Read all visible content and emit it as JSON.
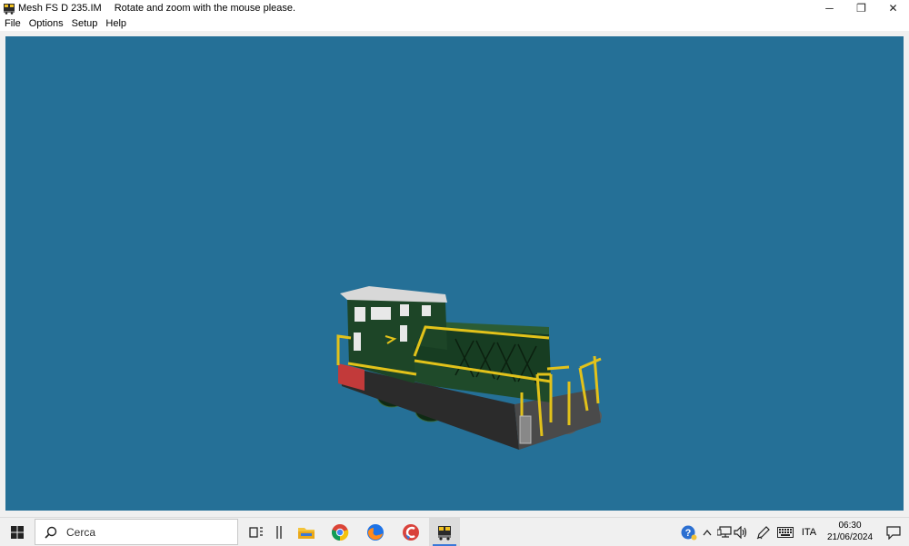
{
  "window": {
    "title": "Mesh FS D 235.IM",
    "hint": "Rotate and zoom with the mouse please.",
    "icon": "locomotive-icon",
    "controls": {
      "minimize": "─",
      "restore": "❐",
      "close": "✕"
    }
  },
  "menu": {
    "items": [
      "File",
      "Options",
      "Setup",
      "Help"
    ]
  },
  "viewport": {
    "background": "#257097",
    "model": {
      "body_color": "#1f4a2a",
      "stripe_color": "#e2c21a",
      "roof_color": "#d8d8d8",
      "buffer_color": "#c23a3a"
    }
  },
  "taskbar": {
    "search_placeholder": "Cerca",
    "apps": [
      "task-view-icon",
      "widgets-icon",
      "file-explorer-icon",
      "chrome-icon",
      "firefox-icon",
      "ccleaner-icon",
      "locomotive-app-icon"
    ],
    "tray": {
      "language": "ITA",
      "time": "06:30",
      "date": "21/06/2024"
    }
  }
}
